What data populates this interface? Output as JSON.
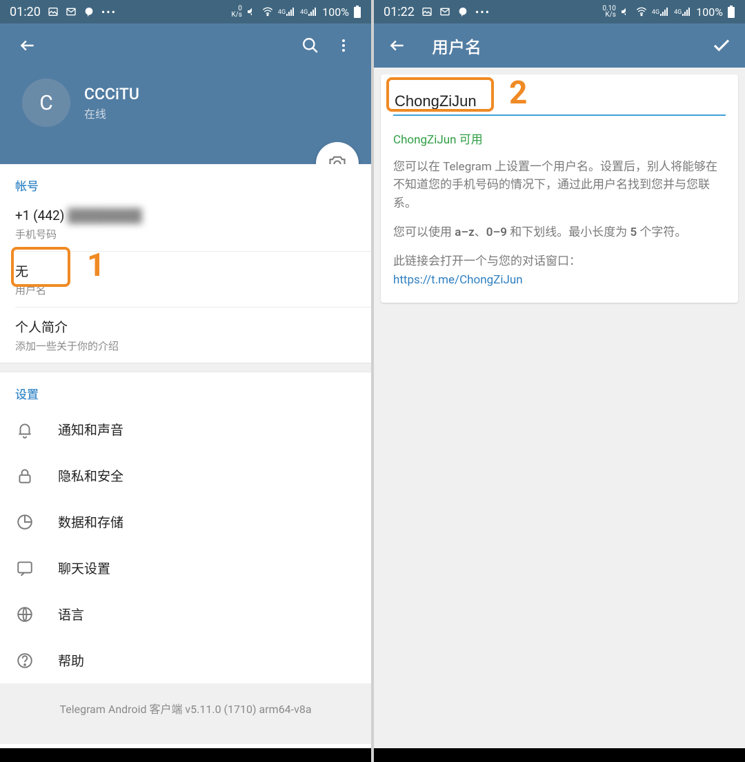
{
  "colors": {
    "header": "#527da3",
    "statusbar": "#40667f",
    "accent": "#3a8ac8",
    "highlight": "#f08a24",
    "available": "#2f9e44",
    "link": "#2f7fc0"
  },
  "annotations": {
    "box1_number": "1",
    "box2_number": "2"
  },
  "left": {
    "status": {
      "time": "01:20",
      "speed_top": "0",
      "speed_unit": "K/s",
      "net_label": "4G",
      "battery": "100%"
    },
    "profile": {
      "avatar_letter": "C",
      "name": "CCCiTU",
      "status": "在线"
    },
    "account": {
      "header": "帐号",
      "phone_prefix": "+1 (442)",
      "phone_rest_blurred": "████████",
      "phone_label": "手机号码",
      "username_value": "无",
      "username_label": "用户名",
      "bio_value": "个人简介",
      "bio_label": "添加一些关于你的介绍"
    },
    "settings": {
      "header": "设置",
      "items": [
        {
          "icon": "bell-icon",
          "label": "通知和声音"
        },
        {
          "icon": "lock-icon",
          "label": "隐私和安全"
        },
        {
          "icon": "pie-icon",
          "label": "数据和存储"
        },
        {
          "icon": "chat-icon",
          "label": "聊天设置"
        },
        {
          "icon": "globe-icon",
          "label": "语言"
        },
        {
          "icon": "help-icon",
          "label": "帮助"
        }
      ]
    },
    "footer": "Telegram Android 客户端 v5.11.0 (1710) arm64-v8a"
  },
  "right": {
    "status": {
      "time": "01:22",
      "speed_top": "0.10",
      "speed_unit": "K/s",
      "net_label": "4G",
      "battery": "100%"
    },
    "header_title": "用户名",
    "username_value": "ChongZiJun",
    "available_text": "ChongZiJun 可用",
    "desc1": "您可以在 Telegram 上设置一个用户名。设置后，别人将能够在不知道您的手机号码的情况下，通过此用户名找到您并与您联系。",
    "desc2_prefix": "您可以使用 ",
    "desc2_bold1": "a–z",
    "desc2_mid1": "、",
    "desc2_bold2": "0–9",
    "desc2_mid2": " 和下划线。最小长度为 ",
    "desc2_bold3": "5",
    "desc2_suffix": " 个字符。",
    "desc3": "此链接会打开一个与您的对话窗口：",
    "link": "https://t.me/ChongZiJun"
  }
}
